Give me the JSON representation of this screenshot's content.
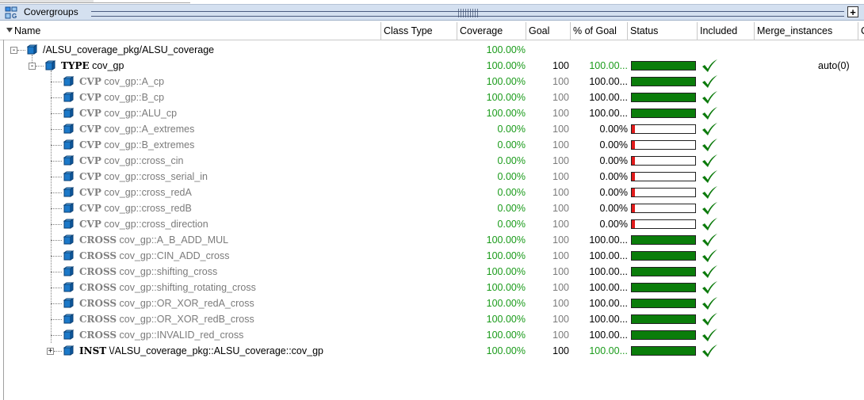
{
  "window": {
    "title": "Covergroups",
    "expand_symbol": "+"
  },
  "columns": [
    "Name",
    "Class Type",
    "Coverage",
    "Goal",
    "% of Goal",
    "Status",
    "Included",
    "Merge_instances",
    "C"
  ],
  "root": {
    "name": "/ALSU_coverage_pkg/ALSU_coverage",
    "coverage": "100.00%"
  },
  "type_row": {
    "kw": "TYPE",
    "name": "cov_gp",
    "coverage": "100.00%",
    "goal": "100",
    "pct": "100.00...",
    "status_fill": 1.0,
    "merge": "auto(0)"
  },
  "items": [
    {
      "kw": "CVP",
      "name": "cov_gp::A_cp",
      "coverage": "100.00%",
      "goal": "100",
      "pct": "100.00...",
      "status_fill": 1.0
    },
    {
      "kw": "CVP",
      "name": "cov_gp::B_cp",
      "coverage": "100.00%",
      "goal": "100",
      "pct": "100.00...",
      "status_fill": 1.0
    },
    {
      "kw": "CVP",
      "name": "cov_gp::ALU_cp",
      "coverage": "100.00%",
      "goal": "100",
      "pct": "100.00...",
      "status_fill": 1.0
    },
    {
      "kw": "CVP",
      "name": "cov_gp::A_extremes",
      "coverage": "0.00%",
      "goal": "100",
      "pct": "0.00%",
      "status_fill": 0.0
    },
    {
      "kw": "CVP",
      "name": "cov_gp::B_extremes",
      "coverage": "0.00%",
      "goal": "100",
      "pct": "0.00%",
      "status_fill": 0.0
    },
    {
      "kw": "CVP",
      "name": "cov_gp::cross_cin",
      "coverage": "0.00%",
      "goal": "100",
      "pct": "0.00%",
      "status_fill": 0.0
    },
    {
      "kw": "CVP",
      "name": "cov_gp::cross_serial_in",
      "coverage": "0.00%",
      "goal": "100",
      "pct": "0.00%",
      "status_fill": 0.0
    },
    {
      "kw": "CVP",
      "name": "cov_gp::cross_redA",
      "coverage": "0.00%",
      "goal": "100",
      "pct": "0.00%",
      "status_fill": 0.0
    },
    {
      "kw": "CVP",
      "name": "cov_gp::cross_redB",
      "coverage": "0.00%",
      "goal": "100",
      "pct": "0.00%",
      "status_fill": 0.0
    },
    {
      "kw": "CVP",
      "name": "cov_gp::cross_direction",
      "coverage": "0.00%",
      "goal": "100",
      "pct": "0.00%",
      "status_fill": 0.0
    },
    {
      "kw": "CROSS",
      "name": "cov_gp::A_B_ADD_MUL",
      "coverage": "100.00%",
      "goal": "100",
      "pct": "100.00...",
      "status_fill": 1.0
    },
    {
      "kw": "CROSS",
      "name": "cov_gp::CIN_ADD_cross",
      "coverage": "100.00%",
      "goal": "100",
      "pct": "100.00...",
      "status_fill": 1.0
    },
    {
      "kw": "CROSS",
      "name": "cov_gp::shifting_cross",
      "coverage": "100.00%",
      "goal": "100",
      "pct": "100.00...",
      "status_fill": 1.0
    },
    {
      "kw": "CROSS",
      "name": "cov_gp::shifting_rotating_cross",
      "coverage": "100.00%",
      "goal": "100",
      "pct": "100.00...",
      "status_fill": 1.0
    },
    {
      "kw": "CROSS",
      "name": "cov_gp::OR_XOR_redA_cross",
      "coverage": "100.00%",
      "goal": "100",
      "pct": "100.00...",
      "status_fill": 1.0
    },
    {
      "kw": "CROSS",
      "name": "cov_gp::OR_XOR_redB_cross",
      "coverage": "100.00%",
      "goal": "100",
      "pct": "100.00...",
      "status_fill": 1.0
    },
    {
      "kw": "CROSS",
      "name": "cov_gp::INVALID_red_cross",
      "coverage": "100.00%",
      "goal": "100",
      "pct": "100.00...",
      "status_fill": 1.0
    }
  ],
  "inst_row": {
    "kw": "INST",
    "name": "\\/ALSU_coverage_pkg::ALSU_coverage::cov_gp",
    "coverage": "100.00%",
    "goal": "100",
    "pct": "100.00...",
    "status_fill": 1.0
  },
  "colors": {
    "full": "#0a7d0a",
    "empty": "#e11b1b",
    "coverage_text": "#1a9b1a",
    "check": "#0a7a0a",
    "header_bg": "#d4e0f0"
  }
}
